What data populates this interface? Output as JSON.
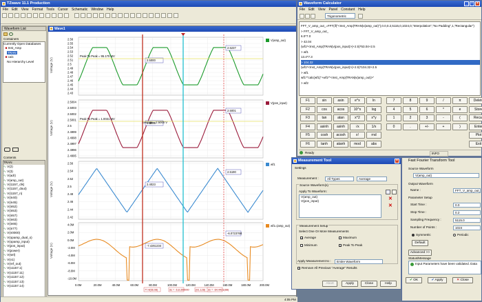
{
  "main": {
    "title": "TZwave 11.1 Production",
    "menu": [
      "File",
      "Edit",
      "View",
      "Format",
      "Tools",
      "Cursor",
      "Schematic",
      "Window",
      "Help"
    ]
  },
  "waveform_list": {
    "header": "Waveform List",
    "containers_label": "Containers",
    "open_db": "Currently Open Databases",
    "db_items": [
      "Inst_Amp",
      "calc",
      "No Hierarchy Level"
    ],
    "db_selected": "TRAN",
    "contents_label": "Contents",
    "contents_header": "TRAN",
    "signals": [
      "V(2)",
      "V(3)",
      "V(adr)",
      "V(amp_out)",
      "V(i1157_clk)",
      "V(i1157_dout)",
      "V(i1157_n)",
      "V(in40)",
      "V(in45)",
      "V(in52)",
      "V(in53)",
      "V(in57)",
      "V(in63)",
      "V(in65)",
      "V(in77)",
      "V(n0000)",
      "V(opamp_dual_o)",
      "V(opamp_input)",
      "V(pos_input)",
      "V(power)",
      "V(sel)",
      "V(v1)",
      "V(ref_out)",
      "V(x1157.1)",
      "V(x1157.11)",
      "V(x1157.12)",
      "V(x1157.13)",
      "V(x1157.14)"
    ]
  },
  "wave1": {
    "title": "Wave1",
    "x_ticks": [
      "0.0M",
      "20.0M",
      "40.0M",
      "60.0M",
      "80.0M",
      "100.0M",
      "120.0M",
      "140.0M",
      "160.0M",
      "180.0M",
      "200.0M"
    ],
    "time_display": "Time (s)",
    "panels": [
      {
        "name": "V(amp_out)",
        "ylabel": "Voltage (V)",
        "yticks": [
          "2.56",
          "2.55",
          "2.54",
          "2.53",
          "2.52",
          "2.51",
          "2.5",
          "2.49",
          "2.48",
          "2.47",
          "2.46",
          "2.45",
          "2.44",
          "2.43"
        ],
        "marker_left": "2.5000",
        "marker_right": "2.5237",
        "annotation": "Peak To Peak = 95.170 MV"
      },
      {
        "name": "V(pos_input)",
        "ylabel": "Voltage (V)",
        "yticks": [
          "2.5004",
          "2.5003",
          "2.5002",
          "2.5001",
          "2.5",
          "2.4999",
          "2.4998",
          "2.4997",
          "2.4996",
          "2.4995"
        ],
        "marker_left": "2.4999",
        "marker_right": "2.5001",
        "annotation": "Peak To Peak = 1.0031 MV",
        "annotation2": "Average = 2.5000 V"
      },
      {
        "name": "wf1",
        "ylabel": "Voltage (V)",
        "yticks": [
          "2.56",
          "2.54",
          "2.52",
          "2.5",
          "2.48",
          "2.46",
          "2.44",
          "2.42"
        ],
        "marker_left": "2.4023",
        "marker_right": "2.5190"
      },
      {
        "name": "wf1=(amp_out)",
        "ylabel": "Voltage (V)",
        "yticks": [
          "4.0M",
          "2.0M",
          "0.0M",
          "-2.0M",
          "-4.0M",
          "-6.0M",
          "-8.0M",
          "-10.0M"
        ],
        "marker_left": "-7.4261234",
        "marker_right": "-6.0723768"
      }
    ],
    "cursor_readout": [
      "77.4(66.08)",
      "ds = -6.8.350000",
      "(91.128)",
      "dx = -64.4421(88)"
    ]
  },
  "calculator": {
    "title": "Waveform Calculator",
    "menu": [
      "File",
      "Edit",
      "View",
      "Panel",
      "Constant",
      "Help"
    ],
    "mode": "Trigonometric",
    "lines": [
      "FFT_V_amp_out_=FFT(if(\"<Inst_Amp|TRAN|v(amp_out)\"),0.0,0.2,5115,0,1024,0,\"Interpolation\",\"No Padding\",1,\"Rectangular\")",
      "> FFT_V_amp_out_",
      "6.0*7.0",
      "> 42.04",
      "(wf1*<Inst_Amp|TRAN|v(pos_input)>)+2.5)*53.04+2.5",
      "> wf1",
      "13.4*7.3",
      "> 104.32",
      "(wf1*<Inst_Amp|TRAN|v(pos_input)>)+2.5)*104.32+2.5",
      "> wf1",
      "wf1*\"calc(wf1)\"+wf1*\"<Inst_Amp|TRAN|v(amp_out)>\"",
      "> wf2"
    ],
    "selected_line": "> 104.32",
    "keys": [
      [
        "F1",
        "sin",
        "asin",
        "e^x",
        "ln",
        "7",
        "8",
        "9",
        "/",
        "π",
        "Delete"
      ],
      [
        "F2",
        "cos",
        "acos",
        "10^x",
        "log",
        "4",
        "5",
        "6",
        "*",
        "e",
        "Store"
      ],
      [
        "F3",
        "tan",
        "atan",
        "x^2",
        "x^y",
        "1",
        "2",
        "3",
        "-",
        "(",
        "Recall"
      ],
      [
        "F4",
        "asinh",
        "asinh",
        "√x",
        "1/x",
        "0",
        ".",
        "+/-",
        "+",
        ")",
        "Enter"
      ],
      [
        "F5",
        "cosh",
        "acosh",
        "x!",
        "rnd",
        "",
        "",
        "",
        "",
        "",
        "Plot"
      ],
      [
        "F6",
        "tanh",
        "atanh",
        "mod",
        "abs",
        "",
        "",
        "",
        "",
        "",
        "Exit"
      ]
    ],
    "status": "Ready",
    "status2": "INFO"
  },
  "measurement": {
    "title": "Measurement Tool",
    "settings": "Settings",
    "measurement_label": "Measurement :",
    "types": "All Types",
    "selected": "Average",
    "source_label": "Source Waveform(s)",
    "apply_to": "Apply To Waveform:",
    "waveforms": [
      "V(amp_out)",
      "V(pos_input)"
    ],
    "setup_label": "Measurement Setup",
    "select_label": "Select One Or More Measurements",
    "options": [
      {
        "label": "Average",
        "checked": true
      },
      {
        "label": "Maximum",
        "checked": false
      },
      {
        "label": "Minimum",
        "checked": false
      },
      {
        "label": "Peak To Peak",
        "checked": true
      }
    ],
    "apply_measurement_label": "Apply Measurement to :",
    "apply_measurement_value": "Entire Waveform",
    "remove_label": "Remove All Previous \"Average\" Results",
    "buttons": [
      "Abort",
      "Apply",
      "Close",
      "Help"
    ]
  },
  "fft": {
    "title": "Fast Fourier Transform Tool",
    "source_label": "Source Waveform",
    "source_value": "V(amp_out)",
    "output_label": "Output Waveform",
    "name_label": "Name :",
    "name_value": "FFT_V_amp_out_",
    "param_label": "Parameter Setup",
    "start_label": "Start Time :",
    "start_value": "0.0",
    "stop_label": "Stop Time :",
    "stop_value": "0.2",
    "freq_label": "Sampling Frequency :",
    "freq_value": "5115.0",
    "points_label": "Number of Points :",
    "points_value": "1024",
    "symmetric": "Symmetric",
    "periodic": "Periodic",
    "default_btn": "Default",
    "advanced_btn": "Advanced >>",
    "status_label": "Status/Message",
    "status_msg": "Input Parameters have been validated. Data",
    "buttons": [
      "OK",
      "Apply",
      "Close"
    ]
  },
  "taskbar": {
    "time": "4:05 PM"
  }
}
